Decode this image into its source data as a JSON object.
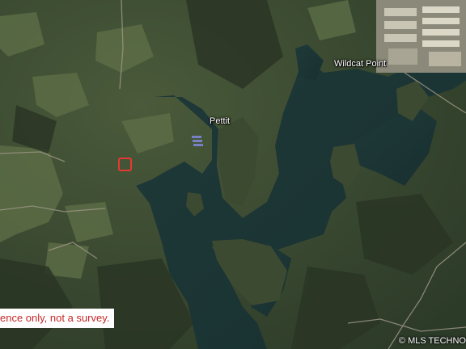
{
  "map": {
    "type": "satellite",
    "place_labels": [
      "Pettit",
      "Wildcat Point"
    ],
    "disclaimer": "ence only, not a survey.",
    "copyright": "© MLS TECHNO",
    "parcel_marker_color": "#e53935"
  }
}
